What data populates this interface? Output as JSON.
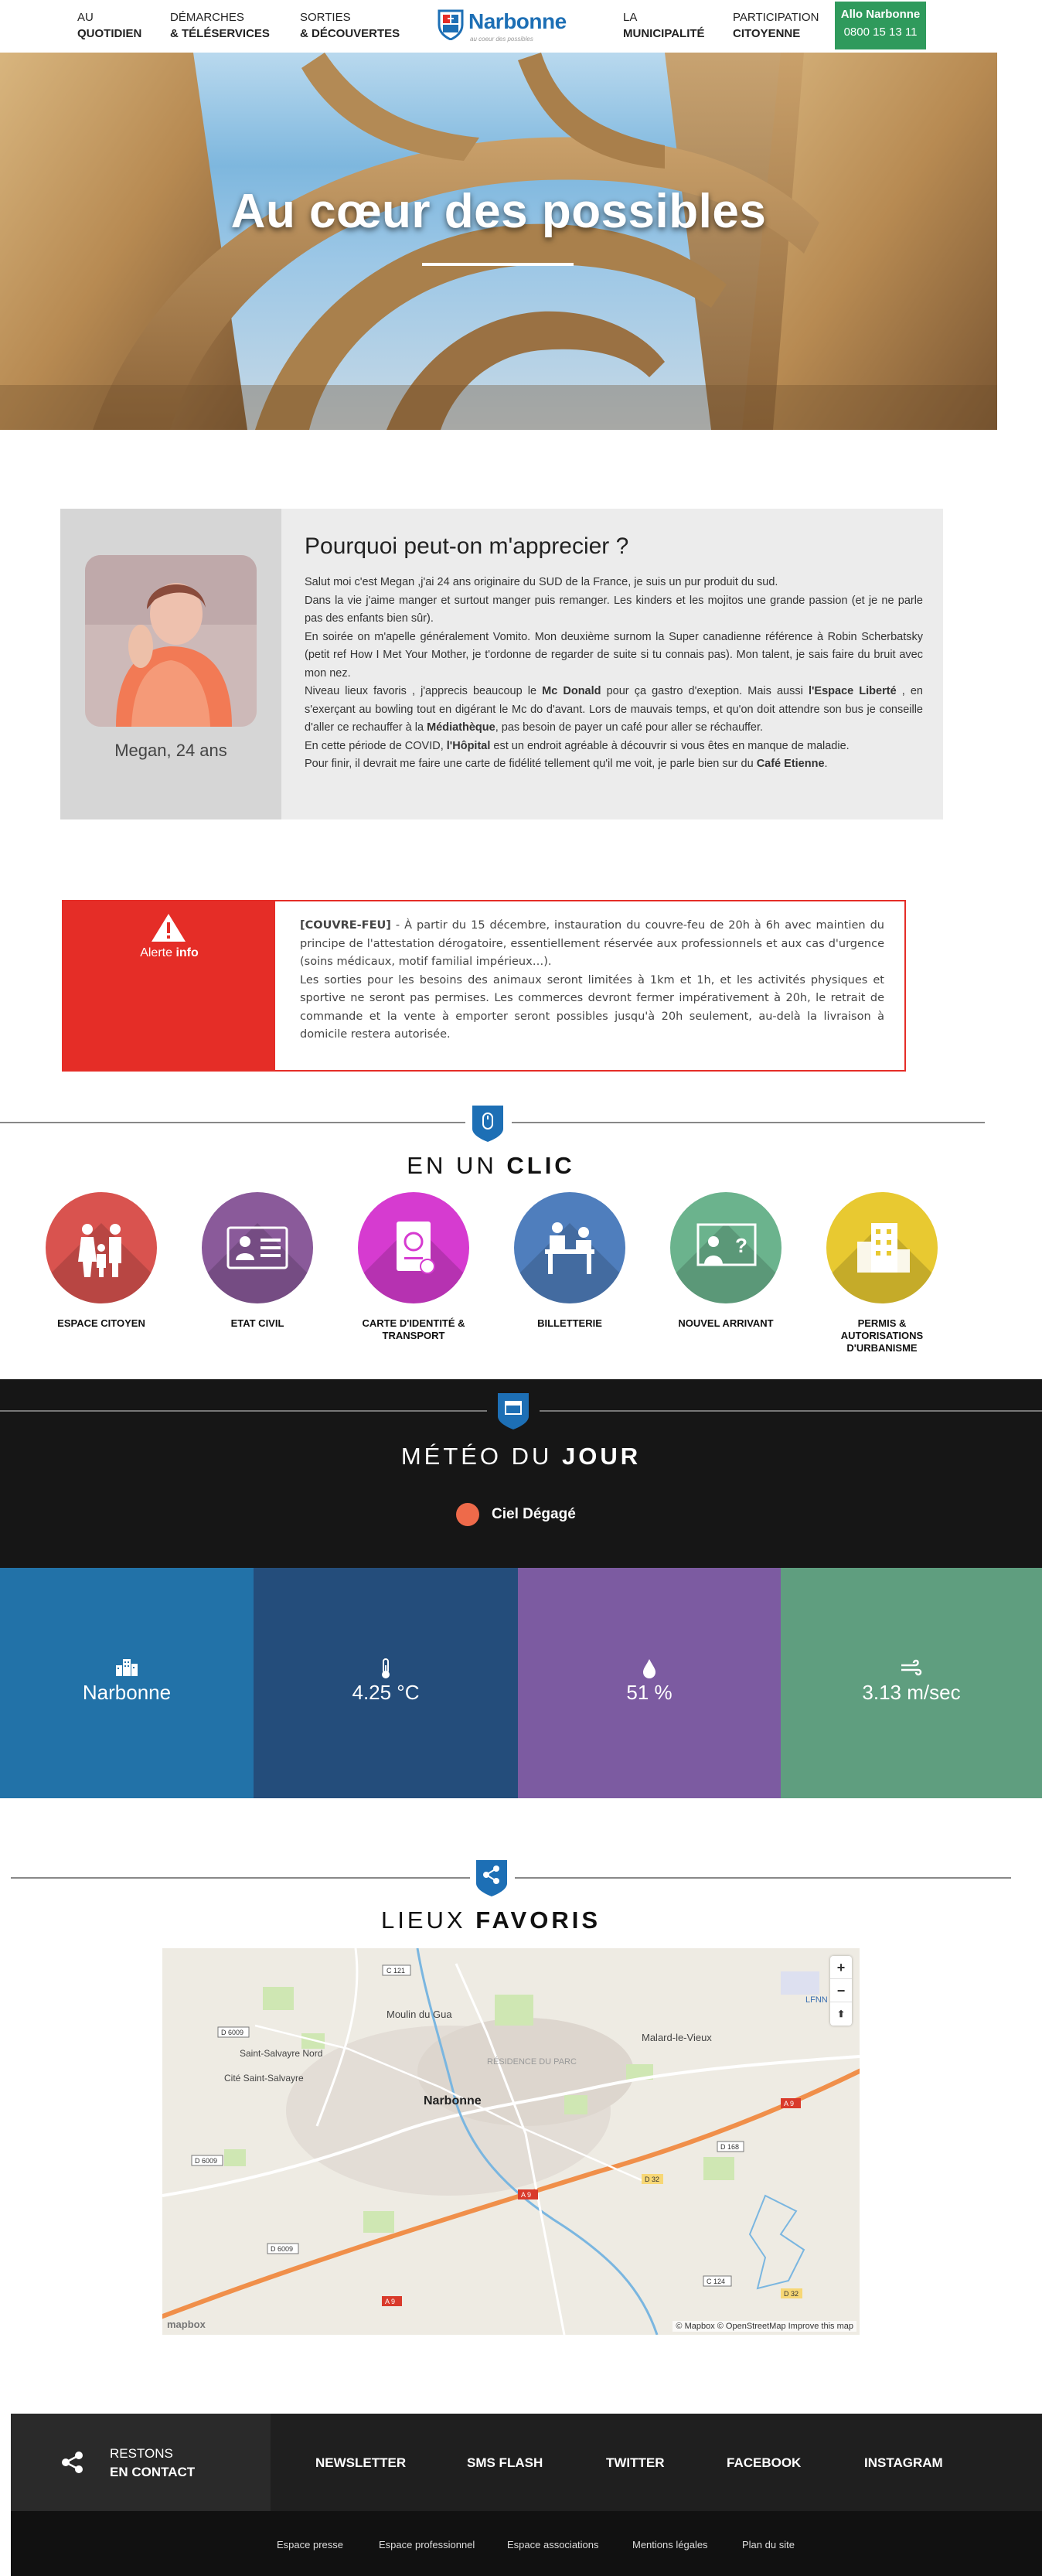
{
  "header": {
    "nav": [
      {
        "line1": "AU",
        "line2": "QUOTIDIEN"
      },
      {
        "line1": "DÉMARCHES",
        "line2": "& TÉLÉSERVICES"
      },
      {
        "line1": "SORTIES",
        "line2": "& DÉCOUVERTES"
      },
      {
        "line1": "LA",
        "line2": "MUNICIPALITÉ"
      },
      {
        "line1": "PARTICIPATION",
        "line2": "CITOYENNE"
      }
    ],
    "logo_name": "Narbonne",
    "logo_tagline": "au coeur des possibles",
    "allo": {
      "title": "Allo Narbonne",
      "number": "0800 15 13 11"
    },
    "accent_color": "#1d6fb5",
    "allo_color": "#2f9a5c"
  },
  "hero": {
    "title": "Au cœur des possibles"
  },
  "profile": {
    "caption": "Megan, 24 ans",
    "heading": "Pourquoi peut-on m'apprecier ?",
    "p1": "Salut moi c'est Megan ,j'ai 24 ans originaire du SUD de la France, je suis un pur produit du sud.",
    "p2": "Dans la vie j'aime manger et surtout manger puis remanger. Les kinders et les mojitos une grande passion (et je ne parle pas des enfants bien sûr).",
    "p3": "En soirée on m'apelle généralement Vomito. Mon deuxième surnom la Super canadienne référence à Robin Scherbatsky (petit ref How I Met Your Mother, je t'ordonne de regarder de suite si tu connais pas). Mon talent, je sais faire du bruit avec mon nez.",
    "p4a": "Niveau lieux favoris , j'apprecis beaucoup le ",
    "p4b": "Mc Donald",
    "p4c": " pour ça gastro d'exeption. Mais aussi ",
    "p4d": "l'Espace Liberté",
    "p4e": " , en s'exerçant au bowling tout en digérant le Mc do d'avant. Lors de mauvais temps, et qu'on doit attendre son bus je conseille d'aller ce rechauffer à la ",
    "p4f": "Médiathèque",
    "p4g": ", pas besoin de payer un café pour aller se réchauffer.",
    "p5a": "En cette période de COVID, ",
    "p5b": "l'Hôpital",
    "p5c": " est un endroit agréable à découvrir si vous êtes en manque de maladie.",
    "p6a": "Pour finir, il devrait me faire une carte de fidélité tellement qu'il me voit, je parle bien sur du ",
    "p6b": "Café Etienne",
    "p6c": "."
  },
  "alert": {
    "label_a": "Alerte ",
    "label_b": "info",
    "tag": "[COUVRE-FEU]",
    "text1": " - À partir du 15 décembre, instauration du couvre-feu de 20h à 6h avec maintien du principe de l'attestation dérogatoire, essentiellement réservée aux professionnels et aux cas d'urgence (soins médicaux, motif familial impérieux…).",
    "text2": "Les sorties pour les besoins des animaux seront limitées à 1km et 1h, et les activités physiques et sportive ne seront pas permises. Les commerces devront fermer impérativement à 20h, le retrait de commande et la vente à emporter seront possibles jusqu'à 20h seulement, au-delà la livraison à domicile restera autorisée.",
    "color": "#e52d27"
  },
  "clic": {
    "title_a": "EN UN ",
    "title_b": "CLIC",
    "items": [
      {
        "label": "ESPACE CITOYEN",
        "color": "#d9534f",
        "icon": "family-icon"
      },
      {
        "label": "ETAT CIVIL",
        "color": "#8a5a9a",
        "icon": "id-card-icon"
      },
      {
        "label": "CARTE D'IDENTITÉ & TRANSPORT",
        "color": "#d63bd0",
        "icon": "passport-icon"
      },
      {
        "label": "BILLETTERIE",
        "color": "#4f7ebd",
        "icon": "ticket-desk-icon"
      },
      {
        "label": "NOUVEL ARRIVANT",
        "color": "#6bb38d",
        "icon": "newcomer-icon"
      },
      {
        "label": "PERMIS & AUTORISATIONS D'URBANISME",
        "color": "#e8c931",
        "icon": "building-icon"
      }
    ]
  },
  "meteo": {
    "title_a": "MÉTÉO DU ",
    "title_b": "JOUR",
    "sky": "Ciel Dégagé",
    "tiles": [
      {
        "value": "Narbonne",
        "icon": "city-icon",
        "color": "#2272a8"
      },
      {
        "value": "4.25 °C",
        "icon": "thermometer-icon",
        "color": "#244d7b"
      },
      {
        "value": "51 %",
        "icon": "drop-icon",
        "color": "#7c5ba1"
      },
      {
        "value": "3.13 m/sec",
        "icon": "wind-icon",
        "color": "#5f9e7f"
      }
    ]
  },
  "lieux": {
    "title_a": "LIEUX ",
    "title_b": "FAVORIS",
    "map": {
      "labels": [
        "Moulin du Gua",
        "Saint-Salvayre Nord",
        "Cité Saint-Salvayre",
        "RÉSIDENCE DU PARC",
        "Narbonne",
        "Malard-le-Vieux",
        "LFNN"
      ],
      "roads": [
        "C 121",
        "D 6009",
        "D 6009",
        "D 6009",
        "A 9",
        "A 9",
        "A 9",
        "D 168",
        "D 32",
        "D 32",
        "C 124"
      ],
      "zoom_in": "+",
      "zoom_out": "−",
      "compass": "⬆",
      "logo": "mapbox",
      "attribution": "© Mapbox © OpenStreetMap Improve this map"
    }
  },
  "footer": {
    "contact_a": "RESTONS",
    "contact_b": "EN CONTACT",
    "links": [
      "NEWSLETTER",
      "SMS FLASH",
      "TWITTER",
      "FACEBOOK",
      "INSTAGRAM"
    ],
    "bottom_links": [
      "Espace presse",
      "Espace professionnel",
      "Espace associations",
      "Mentions légales",
      "Plan du site"
    ]
  }
}
